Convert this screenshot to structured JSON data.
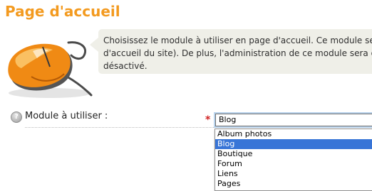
{
  "page": {
    "title": "Page d'accueil"
  },
  "info": {
    "lines": [
      "Choisissez le module à utiliser en page d'accueil. Ce module sera c",
      "d'accueil du site). De plus, l'administration de ce module sera dire",
      "désactivé."
    ]
  },
  "form": {
    "module_label": "Module à utiliser :",
    "required_mark": "*",
    "help_glyph": "?",
    "selected_value": "Blog",
    "options": [
      "Album photos",
      "Blog",
      "Boutique",
      "Forum",
      "Liens",
      "Pages"
    ],
    "highlighted_option": "Blog"
  },
  "icons": {
    "logo": "computer-mouse-logo",
    "help": "question-mark-icon"
  },
  "colors": {
    "title": "#f39a1f",
    "info_background": "#efefe8",
    "required": "#d02020",
    "highlight": "#3875d7"
  }
}
